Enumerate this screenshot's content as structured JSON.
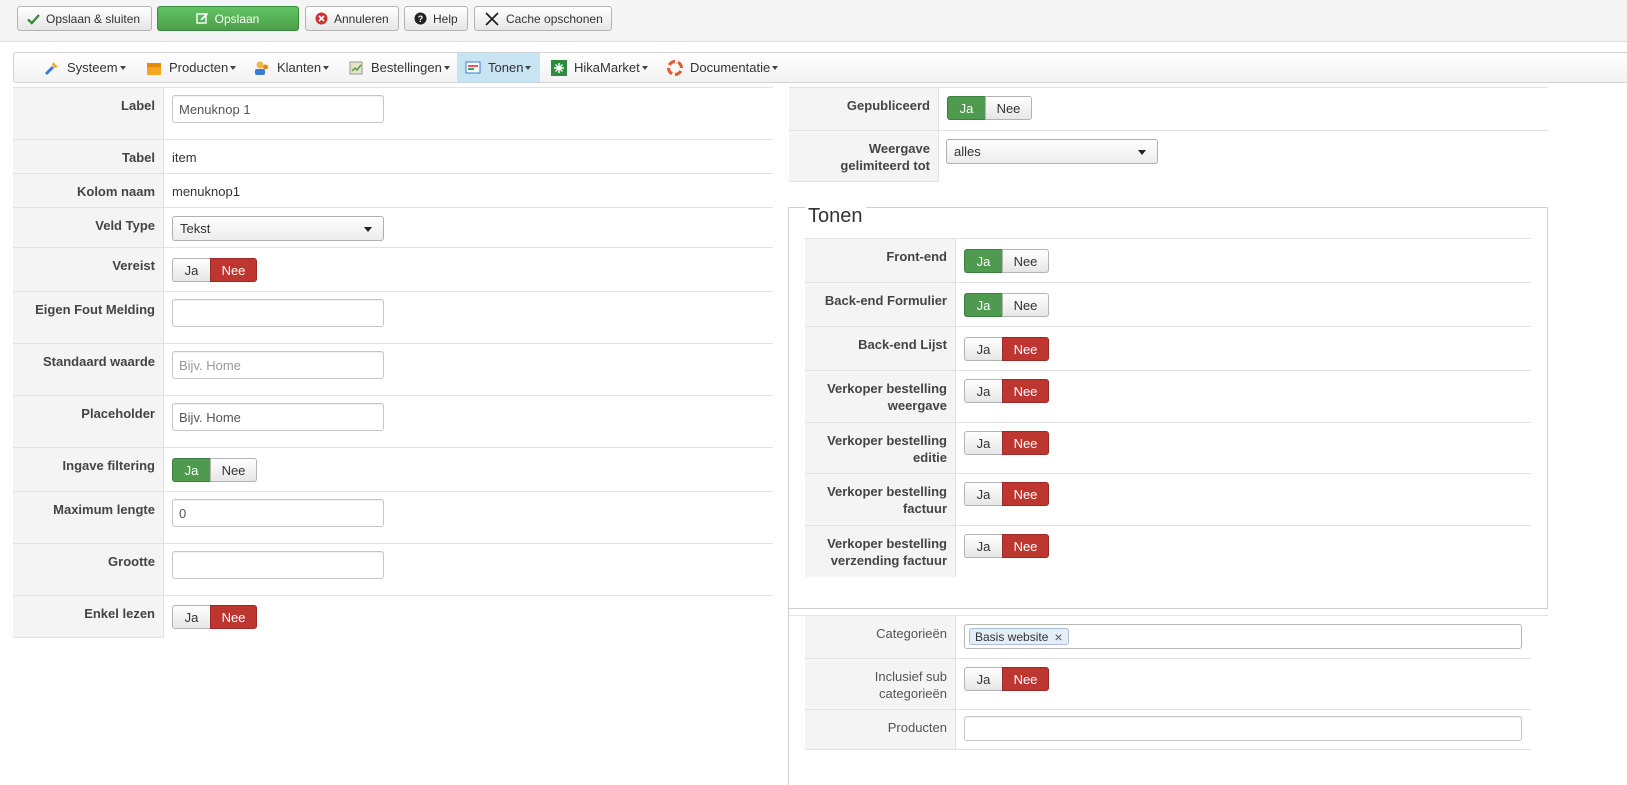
{
  "toolbar": {
    "save_close": "Opslaan & sluiten",
    "save": "Opslaan",
    "cancel": "Annuleren",
    "help": "Help",
    "clear_cache": "Cache opschonen"
  },
  "menu": {
    "items": [
      {
        "label": "Systeem",
        "icon": "tools-icon"
      },
      {
        "label": "Producten",
        "icon": "box-icon"
      },
      {
        "label": "Klanten",
        "icon": "users-icon"
      },
      {
        "label": "Bestellingen",
        "icon": "orders-icon"
      },
      {
        "label": "Tonen",
        "icon": "display-icon"
      },
      {
        "label": "HikaMarket",
        "icon": "market-icon"
      },
      {
        "label": "Documentatie",
        "icon": "lifebuoy-icon"
      }
    ]
  },
  "left": {
    "label": {
      "label": "Label",
      "value": "Menuknop 1"
    },
    "table": {
      "label": "Tabel",
      "value": "item"
    },
    "column": {
      "label": "Kolom naam",
      "value": "menuknop1"
    },
    "field_type": {
      "label": "Veld Type",
      "value": "Tekst"
    },
    "required": {
      "label": "Vereist"
    },
    "error_msg": {
      "label": "Eigen Fout Melding",
      "value": ""
    },
    "default": {
      "label": "Standaard waarde",
      "value": "",
      "placeholder": "Bijv. Home"
    },
    "placeholder": {
      "label": "Placeholder",
      "value": "Bijv. Home"
    },
    "filtering": {
      "label": "Ingave filtering"
    },
    "maxlength": {
      "label": "Maximum lengte",
      "value": "0"
    },
    "size": {
      "label": "Grootte",
      "value": ""
    },
    "readonly": {
      "label": "Enkel lezen"
    }
  },
  "right": {
    "published": {
      "label": "Gepubliceerd"
    },
    "limited": {
      "label_line1": "Weergave",
      "label_line2": "gelimiteerd tot",
      "value": "alles"
    },
    "tonen": {
      "legend": "Tonen",
      "frontend": {
        "label": "Front-end"
      },
      "backend_form": {
        "label": "Back-end Formulier"
      },
      "backend_list": {
        "label": "Back-end Lijst"
      },
      "vendor_view": {
        "label_line1": "Verkoper bestelling",
        "label_line2": "weergave"
      },
      "vendor_edit": {
        "label_line1": "Verkoper bestelling",
        "label_line2": "editie"
      },
      "vendor_invoice": {
        "label_line1": "Verkoper bestelling",
        "label_line2": "factuur"
      },
      "vendor_shipping": {
        "label_line1": "Verkoper bestelling",
        "label_line2": "verzending factuur"
      }
    },
    "categories": {
      "label": "Categorieën",
      "tag": "Basis website",
      "remove": "×"
    },
    "include_sub": {
      "label_line1": "Inclusief sub",
      "label_line2": "categorieën"
    },
    "products": {
      "label": "Producten",
      "value": ""
    }
  },
  "toggle": {
    "yes": "Ja",
    "no": "Nee"
  },
  "colors": {
    "green": "#4e9a4e",
    "red": "#bd362f",
    "active_menu": "#c8e4f3"
  }
}
